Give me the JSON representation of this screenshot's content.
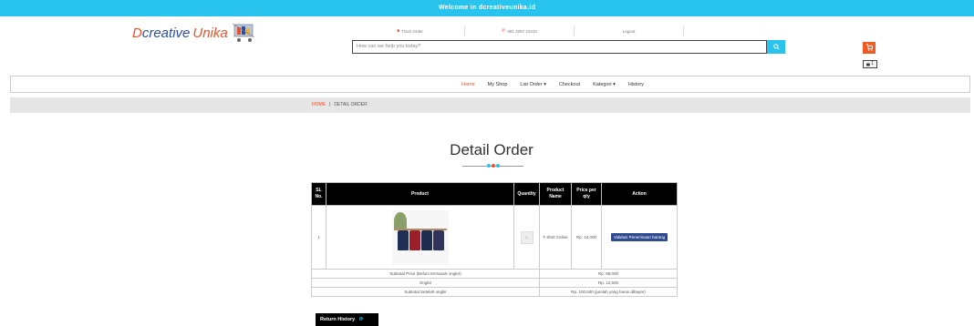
{
  "topbar": {
    "welcome": "Welcome in dcreativeunika.id"
  },
  "logo": {
    "d": "D",
    "creative": "creative",
    "unika": "Unika"
  },
  "toplinks": {
    "track": "Track Order",
    "phone": "081 3257 23410",
    "logout": "Logout"
  },
  "search": {
    "placeholder": "How can we help you today?",
    "icon": "search-icon"
  },
  "cart": {
    "count": "1"
  },
  "nav": {
    "items": [
      "Home",
      "My Shop",
      "List Order ▾",
      "Checkout",
      "Kategori ▾",
      "History"
    ]
  },
  "breadcrumb": {
    "home": "HOME",
    "sep": "|",
    "current": "DETAIL ORDER"
  },
  "page": {
    "title": "Detail Order"
  },
  "table": {
    "headers": {
      "sl": "SL No.",
      "product": "Product",
      "quantity": "Quantity",
      "name": "Product Name",
      "price": "Price per qty",
      "action": "Action"
    },
    "rows": [
      {
        "sl": "1",
        "qty": "2",
        "name": "T-Shirt Celine",
        "price": "Rp. 44,000",
        "action": "Validasi Penerimaan barang"
      }
    ],
    "summary": {
      "subtotal_label": "Subtotal Price (Belum termasuk ongkir)",
      "subtotal_value": "Rp. 88,000",
      "ongkir_label": "Ongkir",
      "ongkir_value": "Rp. 12,500",
      "total_label": "Subtotal Setelah ongkir",
      "total_value": "Rp. 100,500 (jumlah yang harus dibayar)"
    }
  },
  "return_button": {
    "label": "Return History"
  },
  "colors": {
    "accent": "#29c4ee",
    "brand_orange": "#e8532b",
    "brand_blue": "#2b4f9e",
    "button_blue": "#2e4b8f"
  }
}
